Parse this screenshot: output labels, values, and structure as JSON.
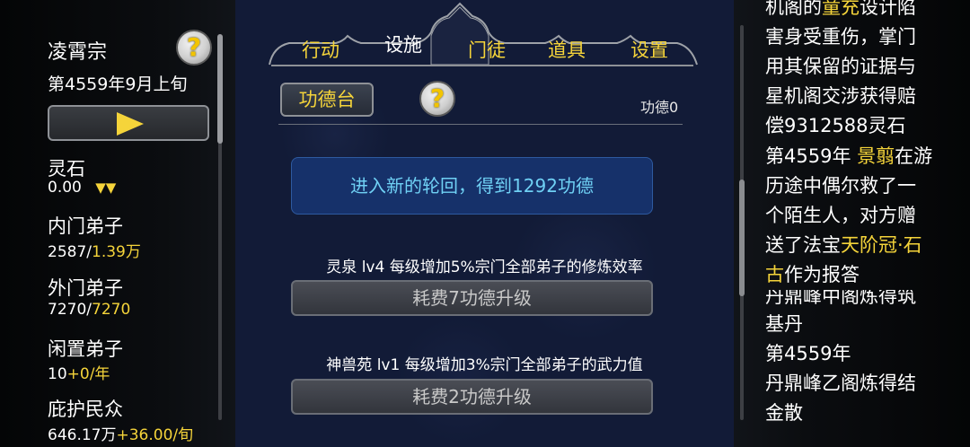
{
  "sidebar": {
    "sect_name": "凌霄宗",
    "help_label": "?",
    "date": "第4559年9月上旬",
    "spirit_stone_label": "灵石",
    "spirit_stone_value": "0.00",
    "spirit_stone_arrows": "▼▼",
    "inner_label": "内门弟子",
    "inner_current": "2587/",
    "inner_max": "1.39万",
    "outer_label": "外门弟子",
    "outer_current": "7270/",
    "outer_max": "7270",
    "idle_label": "闲置弟子",
    "idle_current": "10",
    "idle_rate": "+0/年",
    "people_label": "庇护民众",
    "people_current": "646.17万",
    "people_rate": "+36.00/旬"
  },
  "tabs": [
    {
      "label": "行动"
    },
    {
      "label": "设施"
    },
    {
      "label": "门徒"
    },
    {
      "label": "道具"
    },
    {
      "label": "设置"
    }
  ],
  "main": {
    "facility_button": "功德台",
    "help_label": "?",
    "merit_count": "功德0",
    "notice": "进入新的轮回，得到1292功德",
    "facilities": [
      {
        "desc": "灵泉 lv4 每级增加5%宗门全部弟子的修炼效率",
        "button": "耗费7功德升级"
      },
      {
        "desc": "神兽苑 lv1 每级增加3%宗门全部弟子的武力值",
        "button": "耗费2功德升级"
      }
    ]
  },
  "log": {
    "line1": "机阁的",
    "line1_name": "童充",
    "line1b": "设计陷",
    "line2": "害身受重伤，掌门",
    "line3": "用其保留的证据与",
    "line4": "星机阁交涉获得赔",
    "line5": "偿9312588灵石",
    "line6": "第4559年 ",
    "line6_name": "景翦",
    "line6b": "在游",
    "line7": "历途中偶尔救了一",
    "line8": "个陌生人，对方赠",
    "line9": "送了法宝",
    "line9_item": "天阶冠·石",
    "line10_item": "古",
    "line10b": "作为报答",
    "line11": "丹鼎峰中阁炼得筑",
    "line12": "基丹",
    "line13": "第4559年",
    "line14": "丹鼎峰乙阁炼得结",
    "line15": "金散"
  },
  "colors": {
    "gold": "#f5d43a",
    "notice_text": "#6fd0f4",
    "notice_bg": "#16316a",
    "panel_bg": "#121b37"
  }
}
